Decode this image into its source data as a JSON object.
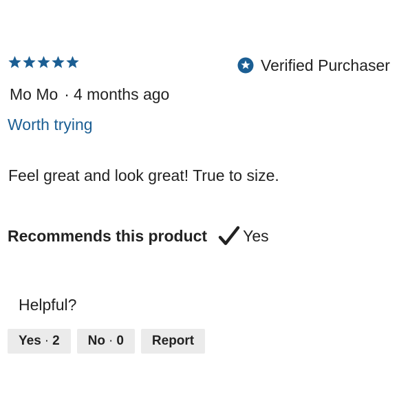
{
  "review": {
    "rating": 5,
    "rating_max": 5,
    "verified_label": "Verified Purchaser",
    "author": "Mo Mo",
    "separator": "·",
    "time_ago": "4 months ago",
    "title": "Worth trying",
    "body": "Feel great and look great! True to size.",
    "recommend_label": "Recommends this product",
    "recommend_value": "Yes"
  },
  "helpful": {
    "label": "Helpful?",
    "yes_label": "Yes",
    "yes_count": "2",
    "no_label": "No",
    "no_count": "0",
    "report_label": "Report"
  },
  "colors": {
    "star": "#1b5e93",
    "link": "#1b5e93",
    "button_bg": "#ebebeb",
    "text": "#222222"
  },
  "icons": {
    "star": "star-icon",
    "verified": "verified-badge-icon",
    "check": "checkmark-icon"
  }
}
